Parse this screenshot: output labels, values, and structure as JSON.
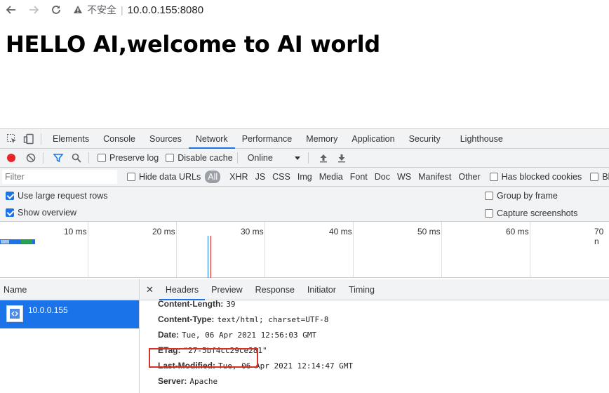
{
  "browser": {
    "warning_text": "不安全",
    "url": "10.0.0.155:8080"
  },
  "page": {
    "title": "HELLO AI,welcome to AI world"
  },
  "devtools": {
    "tabs": [
      "Elements",
      "Console",
      "Sources",
      "Network",
      "Performance",
      "Memory",
      "Application",
      "Security",
      "Lighthouse"
    ],
    "active_tab": "Network",
    "toolbar": {
      "preserve_log": "Preserve log",
      "disable_cache": "Disable cache",
      "throttling": "Online"
    },
    "filter": {
      "placeholder": "Filter",
      "hide_data_urls": "Hide data URLs",
      "types": [
        "All",
        "XHR",
        "JS",
        "CSS",
        "Img",
        "Media",
        "Font",
        "Doc",
        "WS",
        "Manifest",
        "Other"
      ],
      "has_blocked_cookies": "Has blocked cookies",
      "blocked": "Blocked I"
    },
    "options": {
      "use_large_rows": "Use large request rows",
      "show_overview": "Show overview",
      "group_by_frame": "Group by frame",
      "capture_screenshots": "Capture screenshots"
    },
    "overview": {
      "ticks": [
        "10 ms",
        "20 ms",
        "30 ms",
        "40 ms",
        "50 ms",
        "60 ms",
        "70 n"
      ]
    },
    "requests": {
      "column": "Name",
      "rows": [
        {
          "name": "10.0.0.155"
        }
      ]
    },
    "detail_tabs": [
      "Headers",
      "Preview",
      "Response",
      "Initiator",
      "Timing"
    ],
    "headers": [
      {
        "key": "Content-Length:",
        "value": "39"
      },
      {
        "key": "Content-Type:",
        "value": "text/html; charset=UTF-8"
      },
      {
        "key": "Date:",
        "value": "Tue, 06 Apr 2021 12:56:03 GMT"
      },
      {
        "key": "ETag:",
        "value": "\"27-5bf4cc29ce281\""
      },
      {
        "key": "Last-Modified:",
        "value": "Tue, 06 Apr 2021 12:14:47 GMT"
      },
      {
        "key": "Server:",
        "value": "Apache"
      }
    ]
  },
  "colors": {
    "accent": "#1a73e8",
    "record": "#e8262a",
    "highlight": "#d93025"
  }
}
